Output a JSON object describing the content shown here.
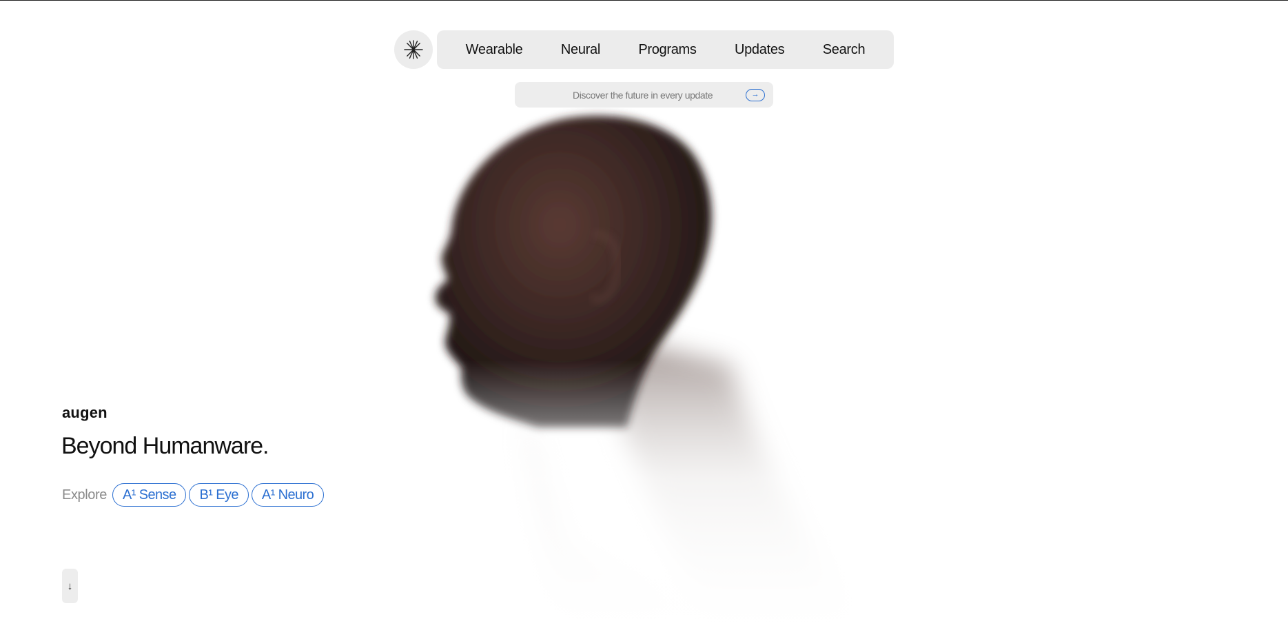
{
  "nav": {
    "logo_icon": "asterisk-burst-icon",
    "items": [
      {
        "label": "Wearable"
      },
      {
        "label": "Neural"
      },
      {
        "label": "Programs"
      },
      {
        "label": "Updates"
      },
      {
        "label": "Search"
      }
    ]
  },
  "promo": {
    "text": "Discover the future in every update",
    "arrow_icon": "arrow-right-icon",
    "arrow_glyph": "→"
  },
  "hero": {
    "brand": "augen",
    "headline": "Beyond Humanware.",
    "explore_label": "Explore",
    "pills": [
      {
        "label": "A¹ Sense"
      },
      {
        "label": "B¹ Eye"
      },
      {
        "label": "A¹ Neuro"
      }
    ],
    "scroll_icon": "arrow-down-icon",
    "scroll_glyph": "↓"
  },
  "colors": {
    "accent": "#2b6fd1",
    "nav_background": "#ececec",
    "page_background": "#ffffff"
  }
}
